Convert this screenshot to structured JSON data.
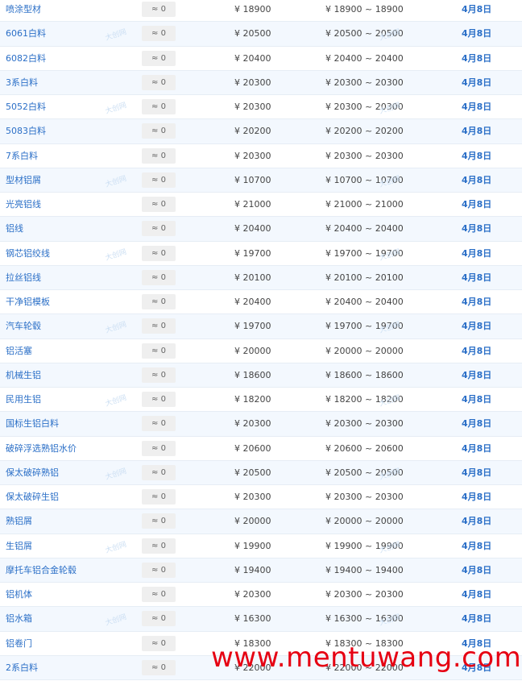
{
  "rows": [
    {
      "name": "喷涂型材",
      "change": "≈ 0",
      "price": "¥ 18900",
      "range": "¥ 18900 ~ 18900",
      "date": "4月8日"
    },
    {
      "name": "6061白料",
      "change": "≈ 0",
      "price": "¥ 20500",
      "range": "¥ 20500 ~ 20500",
      "date": "4月8日"
    },
    {
      "name": "6082白料",
      "change": "≈ 0",
      "price": "¥ 20400",
      "range": "¥ 20400 ~ 20400",
      "date": "4月8日"
    },
    {
      "name": "3系白料",
      "change": "≈ 0",
      "price": "¥ 20300",
      "range": "¥ 20300 ~ 20300",
      "date": "4月8日"
    },
    {
      "name": "5052白料",
      "change": "≈ 0",
      "price": "¥ 20300",
      "range": "¥ 20300 ~ 20300",
      "date": "4月8日"
    },
    {
      "name": "5083白料",
      "change": "≈ 0",
      "price": "¥ 20200",
      "range": "¥ 20200 ~ 20200",
      "date": "4月8日"
    },
    {
      "name": "7系白料",
      "change": "≈ 0",
      "price": "¥ 20300",
      "range": "¥ 20300 ~ 20300",
      "date": "4月8日"
    },
    {
      "name": "型材铝屑",
      "change": "≈ 0",
      "price": "¥ 10700",
      "range": "¥ 10700 ~ 10700",
      "date": "4月8日"
    },
    {
      "name": "光亮铝线",
      "change": "≈ 0",
      "price": "¥ 21000",
      "range": "¥ 21000 ~ 21000",
      "date": "4月8日"
    },
    {
      "name": "铝线",
      "change": "≈ 0",
      "price": "¥ 20400",
      "range": "¥ 20400 ~ 20400",
      "date": "4月8日"
    },
    {
      "name": "钢芯铝绞线",
      "change": "≈ 0",
      "price": "¥ 19700",
      "range": "¥ 19700 ~ 19700",
      "date": "4月8日"
    },
    {
      "name": "拉丝铝线",
      "change": "≈ 0",
      "price": "¥ 20100",
      "range": "¥ 20100 ~ 20100",
      "date": "4月8日"
    },
    {
      "name": "干净铝模板",
      "change": "≈ 0",
      "price": "¥ 20400",
      "range": "¥ 20400 ~ 20400",
      "date": "4月8日"
    },
    {
      "name": "汽车轮毂",
      "change": "≈ 0",
      "price": "¥ 19700",
      "range": "¥ 19700 ~ 19700",
      "date": "4月8日"
    },
    {
      "name": "铝活塞",
      "change": "≈ 0",
      "price": "¥ 20000",
      "range": "¥ 20000 ~ 20000",
      "date": "4月8日"
    },
    {
      "name": "机械生铝",
      "change": "≈ 0",
      "price": "¥ 18600",
      "range": "¥ 18600 ~ 18600",
      "date": "4月8日"
    },
    {
      "name": "民用生铝",
      "change": "≈ 0",
      "price": "¥ 18200",
      "range": "¥ 18200 ~ 18200",
      "date": "4月8日"
    },
    {
      "name": "国标生铝白料",
      "change": "≈ 0",
      "price": "¥ 20300",
      "range": "¥ 20300 ~ 20300",
      "date": "4月8日"
    },
    {
      "name": "破碎浮选熟铝水价",
      "change": "≈ 0",
      "price": "¥ 20600",
      "range": "¥ 20600 ~ 20600",
      "date": "4月8日"
    },
    {
      "name": "保太破碎熟铝",
      "change": "≈ 0",
      "price": "¥ 20500",
      "range": "¥ 20500 ~ 20500",
      "date": "4月8日"
    },
    {
      "name": "保太破碎生铝",
      "change": "≈ 0",
      "price": "¥ 20300",
      "range": "¥ 20300 ~ 20300",
      "date": "4月8日"
    },
    {
      "name": "熟铝屑",
      "change": "≈ 0",
      "price": "¥ 20000",
      "range": "¥ 20000 ~ 20000",
      "date": "4月8日"
    },
    {
      "name": "生铝屑",
      "change": "≈ 0",
      "price": "¥ 19900",
      "range": "¥ 19900 ~ 19900",
      "date": "4月8日"
    },
    {
      "name": "摩托车铝合金轮毂",
      "change": "≈ 0",
      "price": "¥ 19400",
      "range": "¥ 19400 ~ 19400",
      "date": "4月8日"
    },
    {
      "name": "铝机体",
      "change": "≈ 0",
      "price": "¥ 20300",
      "range": "¥ 20300 ~ 20300",
      "date": "4月8日"
    },
    {
      "name": "铝水箱",
      "change": "≈ 0",
      "price": "¥ 16300",
      "range": "¥ 16300 ~ 16300",
      "date": "4月8日"
    },
    {
      "name": "铝卷门",
      "change": "≈ 0",
      "price": "¥ 18300",
      "range": "¥ 18300 ~ 18300",
      "date": "4月8日"
    },
    {
      "name": "2系白料",
      "change": "≈ 0",
      "price": "¥ 22000",
      "range": "¥ 22000 ~ 22000",
      "date": "4月8日"
    }
  ],
  "watermark_faint": "大创网",
  "watermark_text": "www.mentuwang.com",
  "colors": {
    "link": "#2b6fc7",
    "alt_row": "#f3f8fe",
    "watermark": "#e60012"
  }
}
